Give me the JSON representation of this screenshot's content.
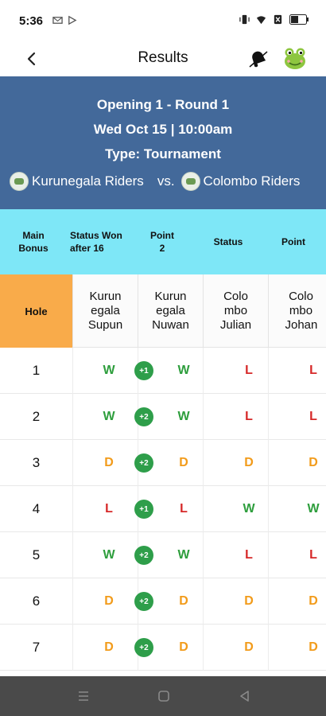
{
  "status_bar": {
    "time": "5:36",
    "left_icons": [
      "mail-icon",
      "mail-icon",
      "play-icon"
    ],
    "right_icons": [
      "vibrate-icon",
      "wifi-icon",
      "no-sim-icon",
      "battery-icon"
    ],
    "battery_level": "41"
  },
  "app_bar": {
    "title": "Results",
    "back_icon": "chevron-left-icon",
    "bell_icon": "bell-icon",
    "avatar_icon": "frog-avatar"
  },
  "match": {
    "line1": "Opening 1 - Round 1",
    "line2": "Wed Oct 15 | 10:00am",
    "line3": "Type: Tournament",
    "team_a": "Kurunegala Riders",
    "vs": "vs.",
    "team_b": "Colombo Riders"
  },
  "summary": {
    "main_bonus": "Main Bonus",
    "status_a": "Status Won after 16",
    "point_a_label": "Point",
    "point_a_value": "2",
    "status_b": "Status",
    "point_b_label": "Point"
  },
  "table": {
    "hole_header": "Hole",
    "players": [
      "Kurun egala Supun",
      "Kurun egala Nuwan",
      "Colo mbo Julian",
      "Colo mbo Johan"
    ],
    "rows": [
      {
        "hole": "1",
        "p1": "W",
        "badge": "+1",
        "p2": "W",
        "p3": "L",
        "p4": "L"
      },
      {
        "hole": "2",
        "p1": "W",
        "badge": "+2",
        "p2": "W",
        "p3": "L",
        "p4": "L"
      },
      {
        "hole": "3",
        "p1": "D",
        "badge": "+2",
        "p2": "D",
        "p3": "D",
        "p4": "D"
      },
      {
        "hole": "4",
        "p1": "L",
        "badge": "+1",
        "p2": "L",
        "p3": "W",
        "p4": "W"
      },
      {
        "hole": "5",
        "p1": "W",
        "badge": "+2",
        "p2": "W",
        "p3": "L",
        "p4": "L"
      },
      {
        "hole": "6",
        "p1": "D",
        "badge": "+2",
        "p2": "D",
        "p3": "D",
        "p4": "D"
      },
      {
        "hole": "7",
        "p1": "D",
        "badge": "+2",
        "p2": "D",
        "p3": "D",
        "p4": "D"
      }
    ]
  },
  "colors": {
    "header_blue": "#43699a",
    "summary_cyan": "#7ee7f7",
    "hole_orange": "#f9ab4a",
    "win_green": "#2e9e3d",
    "loss_red": "#d62828",
    "draw_orange": "#f29b1a",
    "badge_green": "#2e9e4a"
  },
  "nav_bar": {
    "icons": [
      "menu-icon",
      "home-square-icon",
      "back-triangle-icon"
    ]
  }
}
